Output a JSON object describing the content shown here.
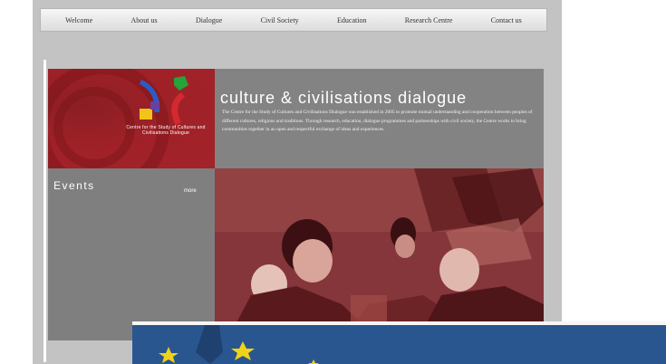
{
  "nav": {
    "items": [
      {
        "label": "Welcome"
      },
      {
        "label": "About us"
      },
      {
        "label": "Dialogue"
      },
      {
        "label": "Civil Society"
      },
      {
        "label": "Education"
      },
      {
        "label": "Research Centre"
      },
      {
        "label": "Contact us"
      }
    ]
  },
  "logo": {
    "caption": "Centre for the Study of Cultures and Civilisations Dialogue"
  },
  "header": {
    "title": "culture & civilisations dialogue",
    "intro": "The Centre for the Study of Cultures and Civilisations Dialogue was established in 2005 to promote mutual understanding and cooperation between peoples of different cultures, religions and traditions. Through research, education, dialogue programmes and partnerships with civil society, the Centre works to bring communities together in an open and respectful exchange of ideas and experiences."
  },
  "sidebar": {
    "heading": "Events",
    "more_label": "more"
  },
  "colors": {
    "nav_bg": "#e6e6e6",
    "logo_red": "#a3232a",
    "panel_gray": "#838383",
    "photo_tint": "#8b3a3a",
    "banner_blue": "#2a568f",
    "eu_star_yellow": "#f0d21a",
    "logo_blue": "#2b5cc6",
    "logo_green": "#27a33b",
    "logo_yellow": "#f0c419"
  },
  "icons": {
    "logo": "dialogue-logo-icon"
  }
}
